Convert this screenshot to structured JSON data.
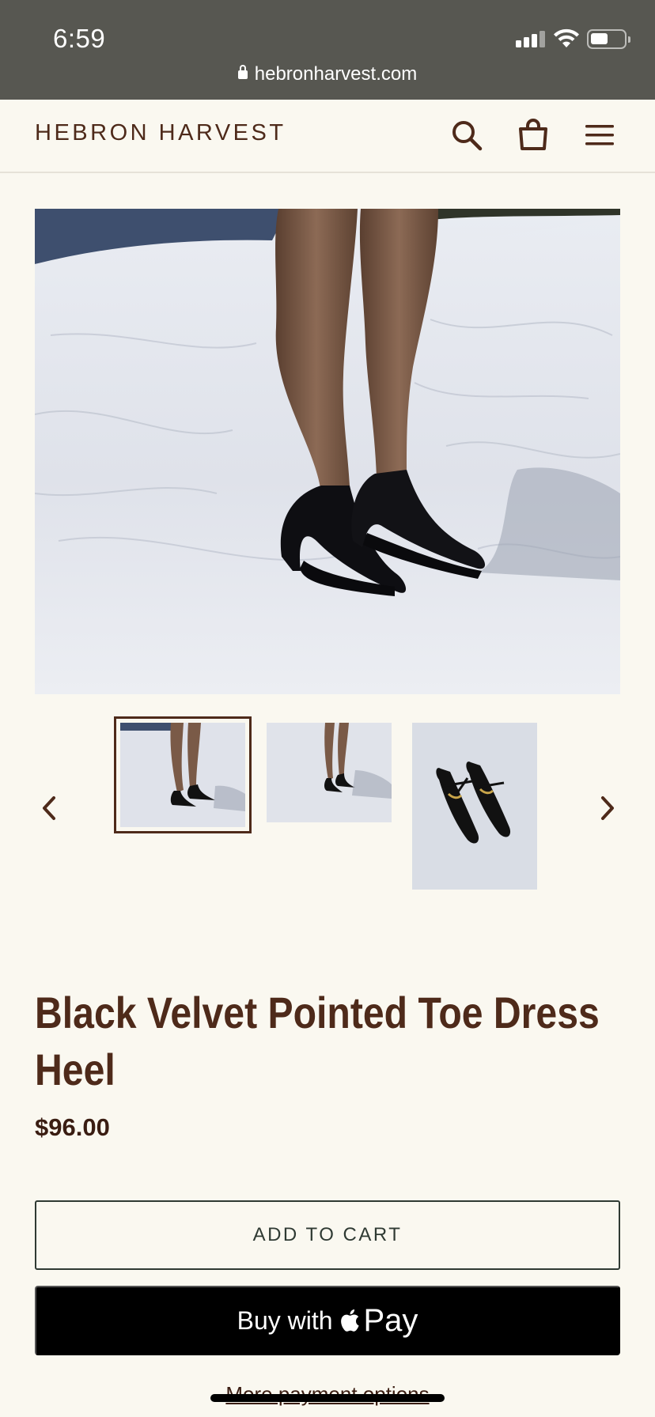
{
  "status_bar": {
    "time": "6:59"
  },
  "browser": {
    "url": "hebronharvest.com"
  },
  "header": {
    "logo": "HEBRON HARVEST",
    "icons": [
      "search-icon",
      "cart-icon",
      "hamburger-menu-icon"
    ]
  },
  "gallery": {
    "prev_icon": "chevron-left-icon",
    "next_icon": "chevron-right-icon",
    "thumbnail_count": 3,
    "active_thumbnail": 1
  },
  "product": {
    "title": "Black Velvet Pointed Toe Dress Heel",
    "price": "$96.00"
  },
  "actions": {
    "add_to_cart": "ADD TO CART",
    "buy_with": "Buy with",
    "pay": "Pay",
    "more_options": "More payment options"
  },
  "colors": {
    "brand_brown": "#4e2a1a",
    "page_background": "#faf8f0",
    "status_bar": "#575751"
  }
}
